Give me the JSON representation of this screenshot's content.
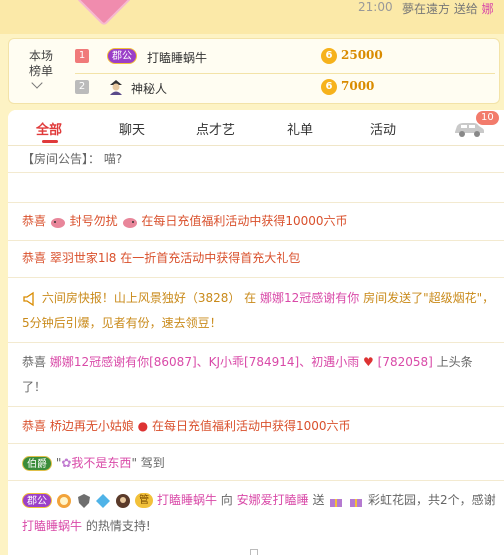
{
  "topbar": {
    "time": "21:00",
    "message": "夢在遠方 送给 ",
    "message_tail": "娜"
  },
  "ranking": {
    "label": "本场\n榜单",
    "rows": [
      {
        "rank": "1",
        "badge": "郡公",
        "name": "打瞌睡蜗牛",
        "coin_icon": "6",
        "amount": "25000"
      },
      {
        "rank": "2",
        "name": "神秘人",
        "coin_icon": "6",
        "amount": "7000"
      }
    ]
  },
  "tabs": [
    "全部",
    "聊天",
    "点才艺",
    "礼单",
    "活动"
  ],
  "car_badge": "10",
  "announcement": {
    "label": "【房间公告】：",
    "text": "喵?"
  },
  "messages": {
    "m1": {
      "prefix": "恭喜 ",
      "user": "封号勿扰",
      "text": " 在每日充值福利活动中获得10000六币"
    },
    "m2": {
      "prefix": "恭喜 ",
      "user": "翠羽世家1l8",
      "text": " 在一折首充活动中获得首充大礼包"
    },
    "m3": {
      "part1": "六间房快报！山上风景独好（3828） 在 ",
      "user": "娜娜12冠感谢有你",
      "part2": " 房间发送了\"超级烟花\"，5分钟后引爆，见者有份，速去领豆！"
    },
    "m4": {
      "prefix": "恭喜 ",
      "u1": "娜娜12冠感谢有你[86087]、KJ小乖[784914]、初遇小雨",
      "u2": "[782058]",
      "text": " 上头条了！"
    },
    "m5": {
      "prefix": "恭喜 ",
      "user": "桥边再无小姑娘",
      "text": " 在每日充值福利活动中获得1000六币"
    },
    "m6": {
      "badge": "伯爵",
      "quote_open": "\"",
      "user": "我不是东西",
      "quote_close": "\"",
      "text": " 驾到"
    },
    "m7": {
      "badge": "郡公",
      "chip2": "管",
      "user": "打瞌睡蜗牛",
      "mid": " 向 ",
      "target": "安娜爱打瞌睡",
      "send": " 送 ",
      "gift": " 彩虹花园，共2个，感谢 ",
      "thank_user": "打瞌睡蜗牛",
      "end": " 的热情支持!"
    }
  },
  "colors": {
    "accent_red": "#e03a3a",
    "coin": "#f6b21c",
    "background": "#fdf3c4"
  }
}
